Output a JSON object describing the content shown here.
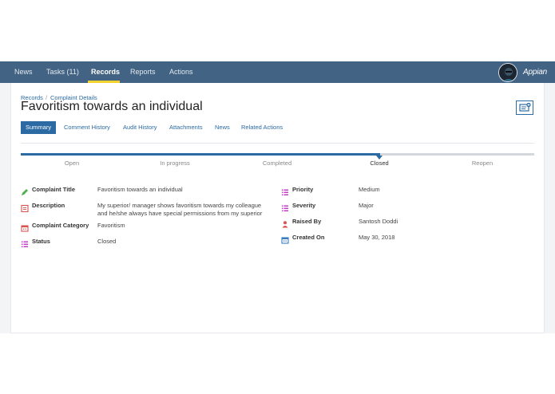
{
  "nav": {
    "items": [
      {
        "label": "News"
      },
      {
        "label": "Tasks (11)"
      },
      {
        "label": "Records"
      },
      {
        "label": "Reports"
      },
      {
        "label": "Actions"
      }
    ],
    "active": "Records",
    "brand": "Appian"
  },
  "breadcrumb": [
    "Records",
    "Complaint Details"
  ],
  "record_title": "Favoritism towards an individual",
  "tabs": [
    "Summary",
    "Comment History",
    "Audit History",
    "Attachments",
    "News",
    "Related Actions"
  ],
  "active_tab": "Summary",
  "status_steps": {
    "steps": [
      "Open",
      "In progress",
      "Completed",
      "Closed",
      "Reopen"
    ],
    "current": "Closed",
    "progress_fraction": 0.7
  },
  "fields_left": [
    {
      "icon": "pencil-icon",
      "label": "Complaint Title",
      "value": "Favoritism towards an individual"
    },
    {
      "icon": "clipboard-icon",
      "label": "Description",
      "value_lines": [
        "My superior/ manager shows favoritism towards my colleague",
        "and he/she always have special permissions from my superior"
      ]
    },
    {
      "icon": "calendar-icon",
      "label": "Complaint Category",
      "value": "Favoritism"
    },
    {
      "icon": "list-icon",
      "label": "Status",
      "value": "Closed"
    }
  ],
  "fields_right": [
    {
      "icon": "list-icon",
      "label": "Priority",
      "value": "Medium"
    },
    {
      "icon": "list-icon",
      "label": "Severity",
      "value": "Major"
    },
    {
      "icon": "user-icon",
      "label": "Raised By",
      "value": "Santosh Doddi"
    },
    {
      "icon": "calendar-icon",
      "label": "Created On",
      "value": "May 30, 2018"
    }
  ],
  "colors": {
    "nav_bar": "#426384",
    "accent": "#2b6aa3",
    "nav_active_underline": "#f2d330",
    "icon_pencil": "#4caf50",
    "icon_red": "#d9534f",
    "icon_list": "#c23ec9",
    "icon_calendar": "#3a7cc0"
  }
}
